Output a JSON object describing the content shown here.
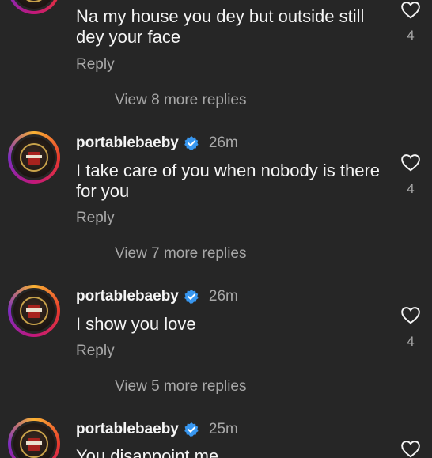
{
  "comments": [
    {
      "username": "",
      "time": "",
      "text": "Na my house you dey but outside still dey your face",
      "reply": "Reply",
      "likes": "4",
      "view_more": "View 8 more replies"
    },
    {
      "username": "portablebaeby",
      "time": "26m",
      "text": "I take care of you when nobody is there for you",
      "reply": "Reply",
      "likes": "4",
      "view_more": "View 7 more replies"
    },
    {
      "username": "portablebaeby",
      "time": "26m",
      "text": "I show you love",
      "reply": "Reply",
      "likes": "4",
      "view_more": "View 5 more replies"
    },
    {
      "username": "portablebaeby",
      "time": "25m",
      "text": "You disappoint me",
      "reply": "",
      "likes": "",
      "view_more": ""
    }
  ],
  "icons": {
    "verified": "verified-badge-icon",
    "heart": "heart-icon"
  },
  "colors": {
    "background": "#262626",
    "primary_text": "#f5f5f5",
    "secondary_text": "#a8a8a8",
    "verified": "#3897f0"
  }
}
